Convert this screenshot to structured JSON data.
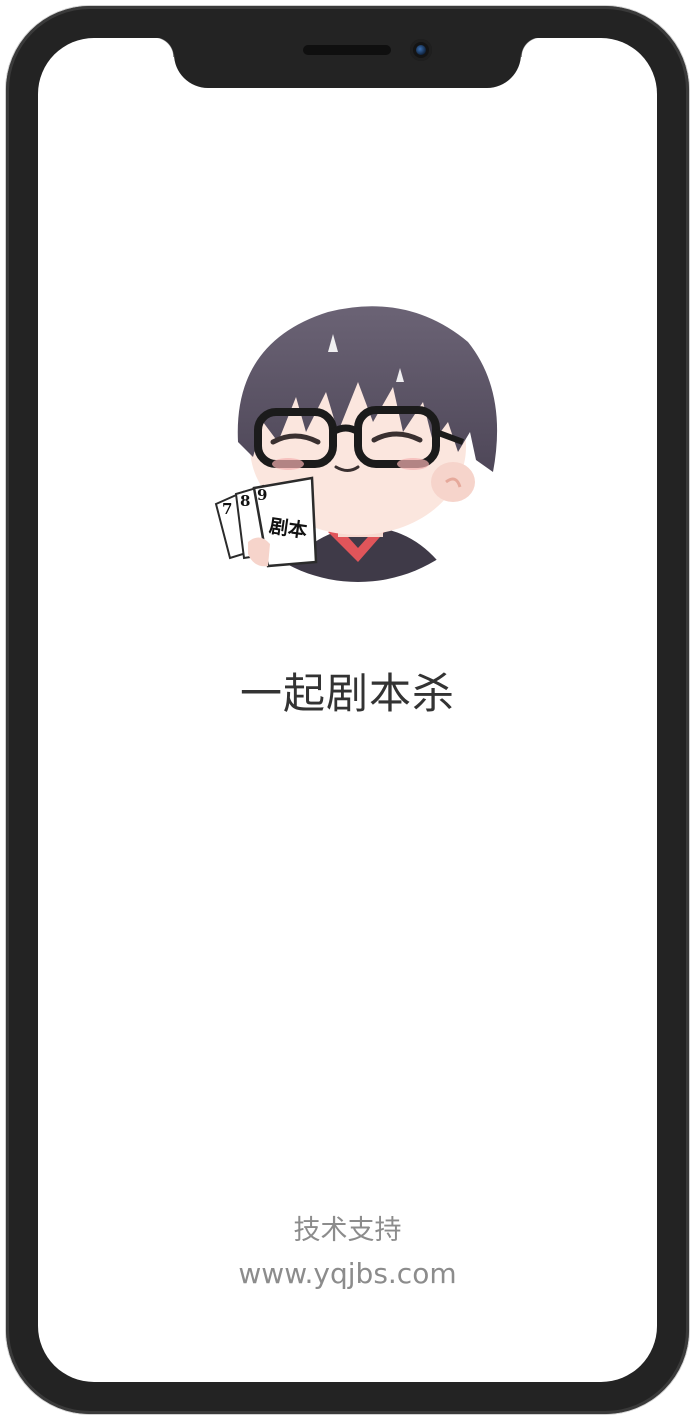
{
  "app": {
    "title": "一起剧本杀"
  },
  "logo": {
    "icon": "anime-boy-with-glasses-holding-script-icon",
    "card_numbers": [
      "7",
      "8",
      "9"
    ],
    "card_text": "剧本"
  },
  "footer": {
    "support_label": "技术支持",
    "support_url": "www.yqjbs.com"
  },
  "colors": {
    "frame": "#232323",
    "screen": "#ffffff",
    "title_text": "#333333",
    "footer_text": "#8c8c8c",
    "hair": "#5e5667",
    "shirt": "#3f3a48",
    "collar": "#e0555a"
  }
}
